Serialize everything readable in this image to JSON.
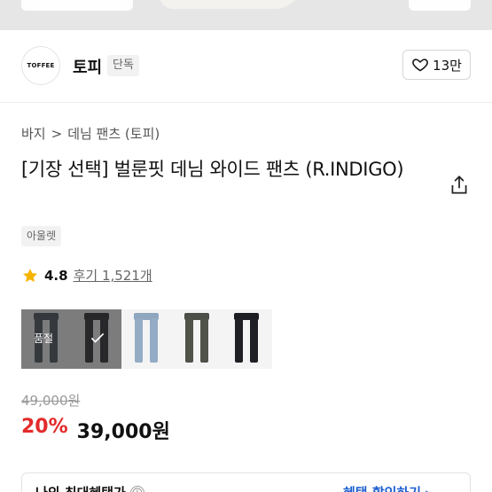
{
  "store": {
    "logo_text": "TOFFEE",
    "name": "토피",
    "tag": "단독",
    "like_count": "13만"
  },
  "breadcrumb": {
    "category": "바지",
    "separator": ">",
    "subcategory": "데님 팬츠 (토피)"
  },
  "product": {
    "title": "[기장 선택] 벌룬핏 데님 와이드 팬츠 (R.INDIGO)",
    "badge": "아울렛",
    "rating": "4.8",
    "reviews": "후기 1,521개",
    "soldout_label": "품절",
    "original_price": "49,000원",
    "discount": "20%",
    "price": "39,000원"
  },
  "benefit": {
    "label": "나의 최대혜택가",
    "info_icon": "ⓘ",
    "link": "혜택 할인하기"
  },
  "colors": {
    "discount": "#e32b2b",
    "link": "#1d5fd1",
    "star": "#f5b400"
  },
  "icons": [
    "heart-icon",
    "share-icon",
    "star-icon",
    "chevron-right-icon",
    "check-icon",
    "info-icon"
  ]
}
